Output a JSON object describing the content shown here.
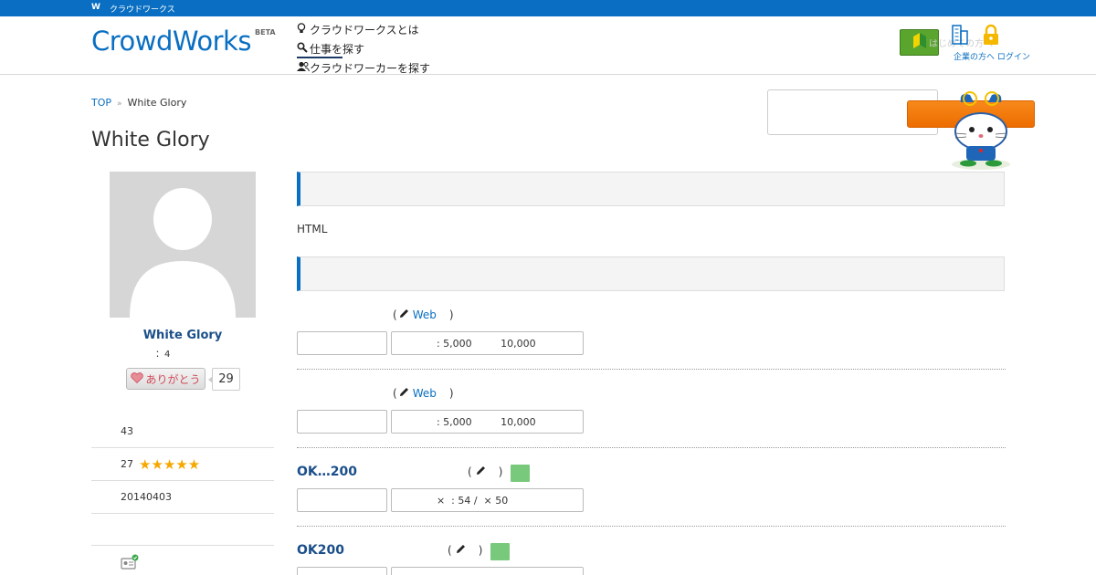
{
  "topbar": {
    "logo_letter": "W",
    "text": "クラウドワークス"
  },
  "header": {
    "logo_text": "CrowdWorks",
    "logo_badge": "BETA",
    "nav": [
      {
        "icon": "lightbulb-icon",
        "glyph": "💡",
        "label": "クラウドワークスとは"
      },
      {
        "icon": "search-icon",
        "glyph": "🔍",
        "label": "仕事を探す"
      },
      {
        "icon": "users-icon",
        "glyph": "👥",
        "label": "クラウドワーカーを探す"
      }
    ],
    "beginner_text": "はじめての方へ",
    "login_label": "企業の方へ ログイン"
  },
  "breadcrumb": {
    "top": "TOP",
    "sep": "»",
    "current": "White Glory"
  },
  "page_title": "White Glory",
  "profile": {
    "name": "White Glory",
    "sub": "：4",
    "thanks_label": "ありがとう",
    "thanks_count": "29",
    "stats": [
      {
        "value": "43",
        "stars": ""
      },
      {
        "value": "27",
        "stars": "★★★★★"
      },
      {
        "value": "20140403",
        "stars": ""
      }
    ]
  },
  "main": {
    "intro_text": "HTML",
    "items": [
      {
        "title": "",
        "head_open": "(",
        "link": "Web",
        "head_close": ")",
        "price": "              : 5,000         10,000"
      },
      {
        "title": "",
        "head_open": "(",
        "link": "Web",
        "head_close": ")",
        "price": "              : 5,000         10,000"
      },
      {
        "title": "OK…200",
        "head_open": "(",
        "link": "",
        "head_close": ")",
        "price": "              ×  : 54 /  × 50"
      },
      {
        "title": "OK200",
        "head_open": "(",
        "link": "",
        "head_close": ")",
        "price": ""
      }
    ]
  },
  "colors": {
    "brand": "#0a6fc2",
    "accent_orange": "#f07800",
    "green": "#78c97b"
  }
}
